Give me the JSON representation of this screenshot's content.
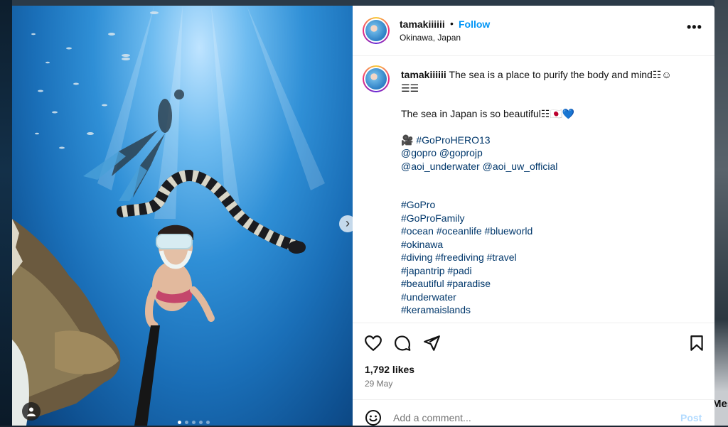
{
  "post": {
    "username": "tamakiiiiii",
    "follow_label": "Follow",
    "separator": "•",
    "location": "Okinawa, Japan",
    "more_icon": "more-horizontal-icon"
  },
  "caption": {
    "username": "tamakiiiiii",
    "line1": "The sea is a place to purify the body and mind☷☺",
    "line1b": "☰☰",
    "line2": "The sea in Japan is so beautiful☷🇯🇵💙",
    "camera_line": "🎥 #GoProHERO13",
    "mentions1": "@gopro @goprojp",
    "mentions2": "@aoi_underwater @aoi_uw_official",
    "hashtags": [
      "#GoPro",
      "#GoProFamily",
      "#ocean #oceanlife #blueworld",
      "#okinawa",
      "#diving #freediving #travel",
      "#japantrip #padi",
      "#beautiful #paradise",
      "#underwater",
      "#keramaislands"
    ]
  },
  "stats": {
    "likes": "1,792 likes",
    "date": "29 May"
  },
  "comment": {
    "placeholder": "Add a comment...",
    "post_label": "Post"
  },
  "carousel": {
    "slides": 5,
    "active_index": 0
  },
  "side": {
    "partial_text": "Mes"
  },
  "colors": {
    "link": "#0095f6",
    "hashtag": "#00376b",
    "post_disabled": "#b3dbff"
  }
}
